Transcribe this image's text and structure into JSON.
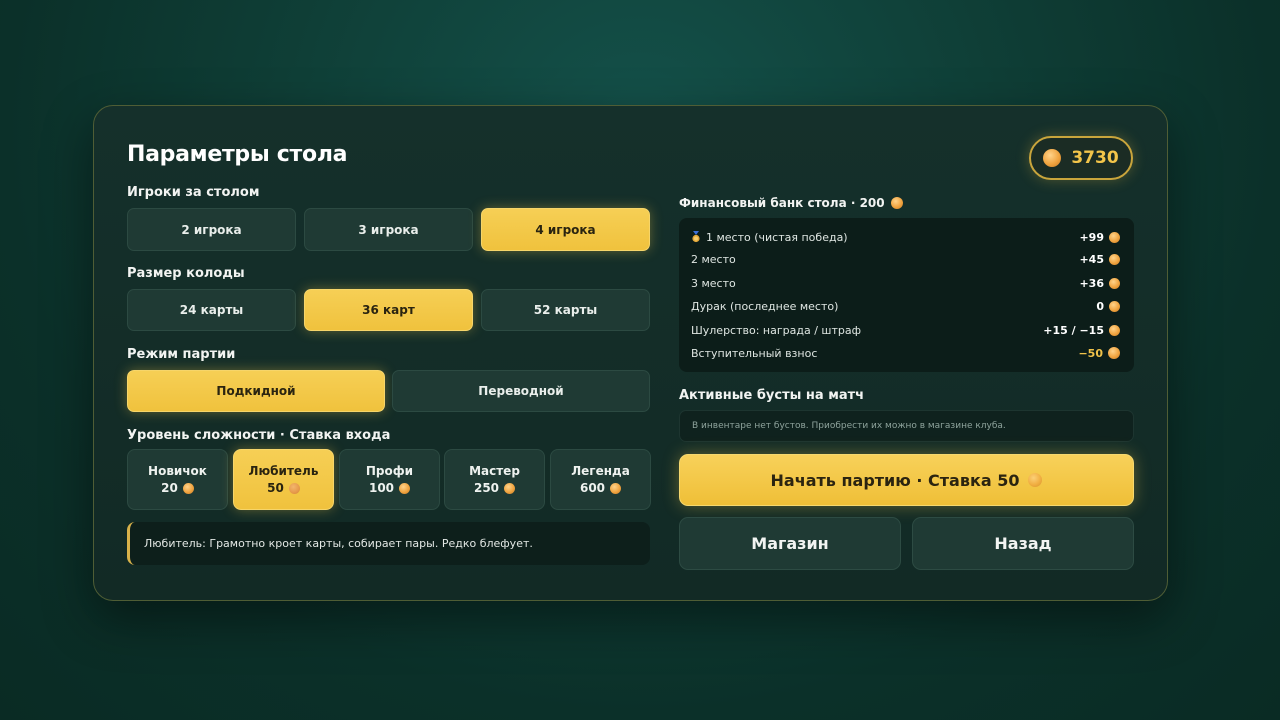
{
  "title": "Параметры стола",
  "balance": {
    "value": "3730",
    "icon": "coin-icon"
  },
  "players": {
    "label": "Игроки за столом",
    "options": [
      "2 игрока",
      "3 игрока",
      "4 игрока"
    ],
    "selected": "4 игрока"
  },
  "deck": {
    "label": "Размер колоды",
    "options": [
      "24 карты",
      "36 карт",
      "52 карты"
    ],
    "selected": "36 карт"
  },
  "mode": {
    "label": "Режим партии",
    "options": [
      "Подкидной",
      "Переводной"
    ],
    "selected": "Подкидной"
  },
  "difficulty": {
    "label": "Уровень сложности · Ставка входа",
    "levels": [
      {
        "name": "Новичок",
        "cost": "20"
      },
      {
        "name": "Любитель",
        "cost": "50"
      },
      {
        "name": "Профи",
        "cost": "100"
      },
      {
        "name": "Мастер",
        "cost": "250"
      },
      {
        "name": "Легенда",
        "cost": "600"
      }
    ],
    "selected": "Любитель",
    "description": "Любитель: Грамотно кроет карты, собирает пары. Редко блефует."
  },
  "bank": {
    "title": "Финансовый банк стола · 200",
    "rows": [
      {
        "label": "1 место (чистая победа)",
        "amount": "+99",
        "icon": "medal-icon"
      },
      {
        "label": "2 место",
        "amount": "+45"
      },
      {
        "label": "3 место",
        "amount": "+36"
      },
      {
        "label": "Дурак (последнее место)",
        "amount": "0"
      },
      {
        "label": "Шулерство: награда / штраф",
        "amount": "+15 / −15"
      },
      {
        "label": "Вступительный взнос",
        "amount": "−50"
      }
    ]
  },
  "boosts": {
    "title": "Активные бусты на матч",
    "empty_text": "В инвентаре нет бустов. Приобрести их можно в магазине клуба."
  },
  "actions": {
    "start": "Начать партию · Ставка 50",
    "shop": "Магазин",
    "back": "Назад"
  },
  "colors": {
    "accent": "#f3c54a",
    "panel": "#15302b",
    "button": "#1f3a34",
    "background": "#0f3f37"
  }
}
